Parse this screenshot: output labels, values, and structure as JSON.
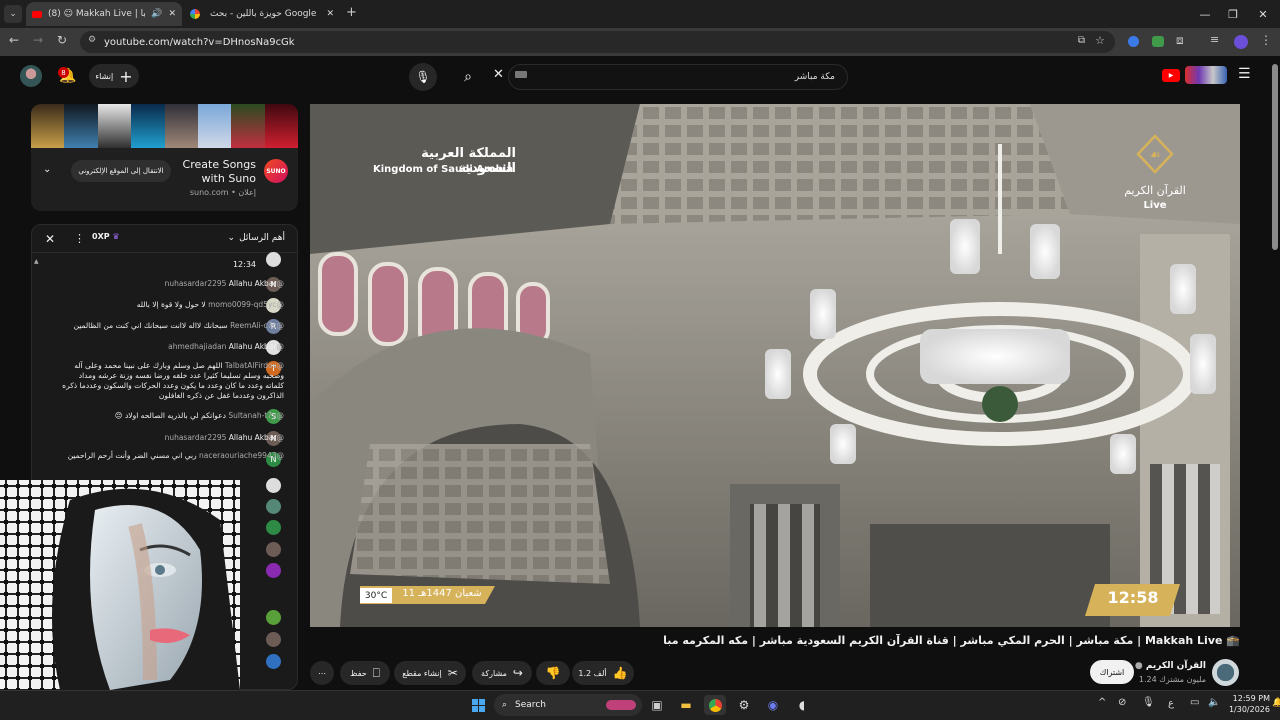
{
  "tabs": [
    {
      "label": "(8) ☺ Makkah Live | مكة مبا"
    },
    {
      "label": "حويزة باللين - بحث Google"
    }
  ],
  "window_controls": {
    "minimize": "—",
    "restore": "❐",
    "close": "✕"
  },
  "address": {
    "url": "youtube.com/watch?v=DHnosNa9cGk"
  },
  "youtube": {
    "notification_count": "8",
    "create_label": "إنشاء",
    "search_value": "مكة مباشر"
  },
  "ad": {
    "title_line1": "Create Songs",
    "title_line2": "with Suno",
    "domain": "suno.com • إعلان",
    "cta": "الانتقال إلى الموقع الإلكتروني",
    "logo_text": "SUNO"
  },
  "chat": {
    "header_title": "أهم الرسائل",
    "xp_label": "0XP",
    "first_time": "12:34",
    "messages": [
      {
        "user": "@nuhasardar2295",
        "text": "Allahu Akbar",
        "avatar": "N",
        "color": "#6d5c55"
      },
      {
        "user": "@momo0099-qd5yc",
        "text": "لا حول ولا قوة إلا بالله",
        "avatar": "",
        "color": "#d8d8c8"
      },
      {
        "user": "@ReemAli-c7c",
        "text": "سبحانك لااله لاانت سبحانك اني كنت من الظالمين",
        "avatar": "R",
        "color": "#6f7fa0"
      },
      {
        "user": "@ahmedhajiadan",
        "text": "Allahu Akbar",
        "avatar": "",
        "color": "#e0e0e0"
      },
      {
        "user": "@TalbatAlFirdos",
        "text": "اللهم صل وسلم وبارك على نبينا محمد وعلى آله وصحبه وسلم تسليما كثيرا عدد خلقه ورضا نفسه وزنة عرشه ومداد كلماته وعدد ما كان وعدد ما يكون وعدد الحركات والسكون وعددما ذكره الذاكرون وعددما غفل عن ذكره الغافلون",
        "avatar": "T",
        "color": "#d06a20"
      },
      {
        "user": "@Sultanah-t7y",
        "text": "دعواتكم لي بالذريه الصالحه اولاد 😔",
        "avatar": "S",
        "color": "#3f9a4a"
      },
      {
        "user": "@nuhasardar2295",
        "text": "Allahu Akbar",
        "avatar": "N",
        "color": "#6d5c55"
      },
      {
        "user": "@naceraouriache9943",
        "text": "ربي اني مسني الضر وأنت أرحم الراحمين",
        "avatar": "N",
        "color": "#2e8b45"
      }
    ]
  },
  "video": {
    "kingdom_ar": "المملكة العربية السعودية",
    "kingdom_en": "Kingdom of Saudi Arabia",
    "channel_ar": "القرآن الكريم",
    "live": "Live",
    "temp": "30°C",
    "date_ar": "11 شعبان 1447هـ",
    "clock": "12:58"
  },
  "below": {
    "title": "🕋 Makkah Live | مكة مباشر | الحرم المكي مباشر | قناة القرآن الكريم السعودية مباشر | مكه المكرمه مبا",
    "channel": "القرآن الكريم",
    "subs": "1.24 مليون مشترك",
    "subscribe": "اشتراك",
    "likes": "1.2 ألف",
    "share": "مشاركة",
    "clip": "إنشاء مقطع",
    "save": "حفظ"
  },
  "taskbar": {
    "search": "Search",
    "time": "12:59 PM",
    "date": "1/30/2026",
    "lang": "ع"
  },
  "colors": {
    "accent": "#ff0000",
    "gold": "#d6b25a"
  }
}
